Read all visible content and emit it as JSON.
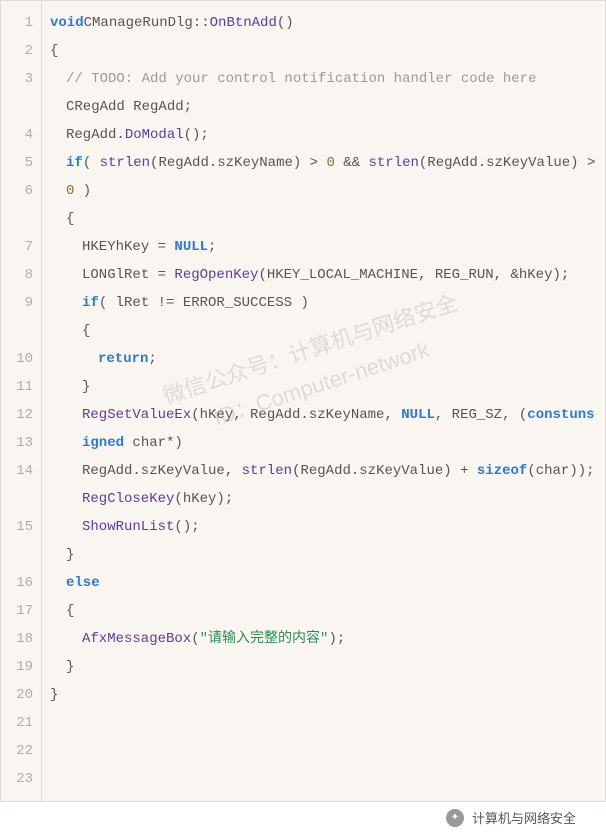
{
  "code": {
    "line1": {
      "kw": "void",
      "cls": "CManageRunDlg",
      "sep": "::",
      "fn": "OnBtnAdd",
      "tail": "()"
    },
    "line2": "{",
    "line3_cmt": "// TODO: Add your control notification handler code here",
    "line4": {
      "a": "CRegAdd RegAdd;"
    },
    "line5": {
      "a": "RegAdd.",
      "fn": "DoModal",
      "b": "();"
    },
    "line6": {
      "kw_if": "if",
      "a": "( ",
      "fn": "strlen",
      "b": "(RegAdd.szKeyName) > ",
      "num1": "0",
      "c": " && ",
      "fn2": "strlen",
      "d": "(RegAdd.szKeyValue) > ",
      "num2": "0",
      "e": " )"
    },
    "line7": "{",
    "line8": {
      "a": "HKEY",
      "b": "hKey = ",
      "nul": "NULL",
      "c": ";"
    },
    "line9": {
      "a": "LONG",
      "b": "lRet = ",
      "fn": "RegOpenKey",
      "c": "(HKEY_LOCAL_MACHINE, REG_RUN, &hKey);"
    },
    "line10": {
      "kw": "if",
      "a": "( lRet != ERROR_SUCCESS )"
    },
    "line11": "{",
    "line12": {
      "kw": "return",
      "a": ";"
    },
    "line13": "}",
    "line14": {
      "fn": "RegSetValueEx",
      "a": "(hKey, RegAdd.szKeyName, ",
      "nul": "NULL",
      "b": ", REG_SZ, (",
      "kw1": "const",
      "kw2": "unsigned",
      "c": " char*)"
    },
    "line15": {
      "a": "RegAdd.szKeyValue, ",
      "fn": "strlen",
      "b": "(RegAdd.szKeyValue) + ",
      "kw": "sizeof",
      "c": "(char));"
    },
    "line16": {
      "fn": "RegCloseKey",
      "a": "(hKey);"
    },
    "line17": {
      "fn": "ShowRunList",
      "a": "();"
    },
    "line18": "}",
    "line19": "else",
    "line20": "{",
    "line21": {
      "fn": "AfxMessageBox",
      "a": "(",
      "str": "\"请输入完整的内容\"",
      "b": ");"
    },
    "line22": "}",
    "line23": "}"
  },
  "line_numbers": [
    "1",
    "2",
    "3",
    "4",
    "5",
    "6",
    "7",
    "8",
    "9",
    "10",
    "11",
    "12",
    "13",
    "14",
    "15",
    "16",
    "17",
    "18",
    "19",
    "20",
    "21",
    "22",
    "23"
  ],
  "watermark": {
    "l1": "微信公众号：计算机与网络安全",
    "l2": "ID：Computer-network"
  },
  "footer_text": "计算机与网络安全"
}
